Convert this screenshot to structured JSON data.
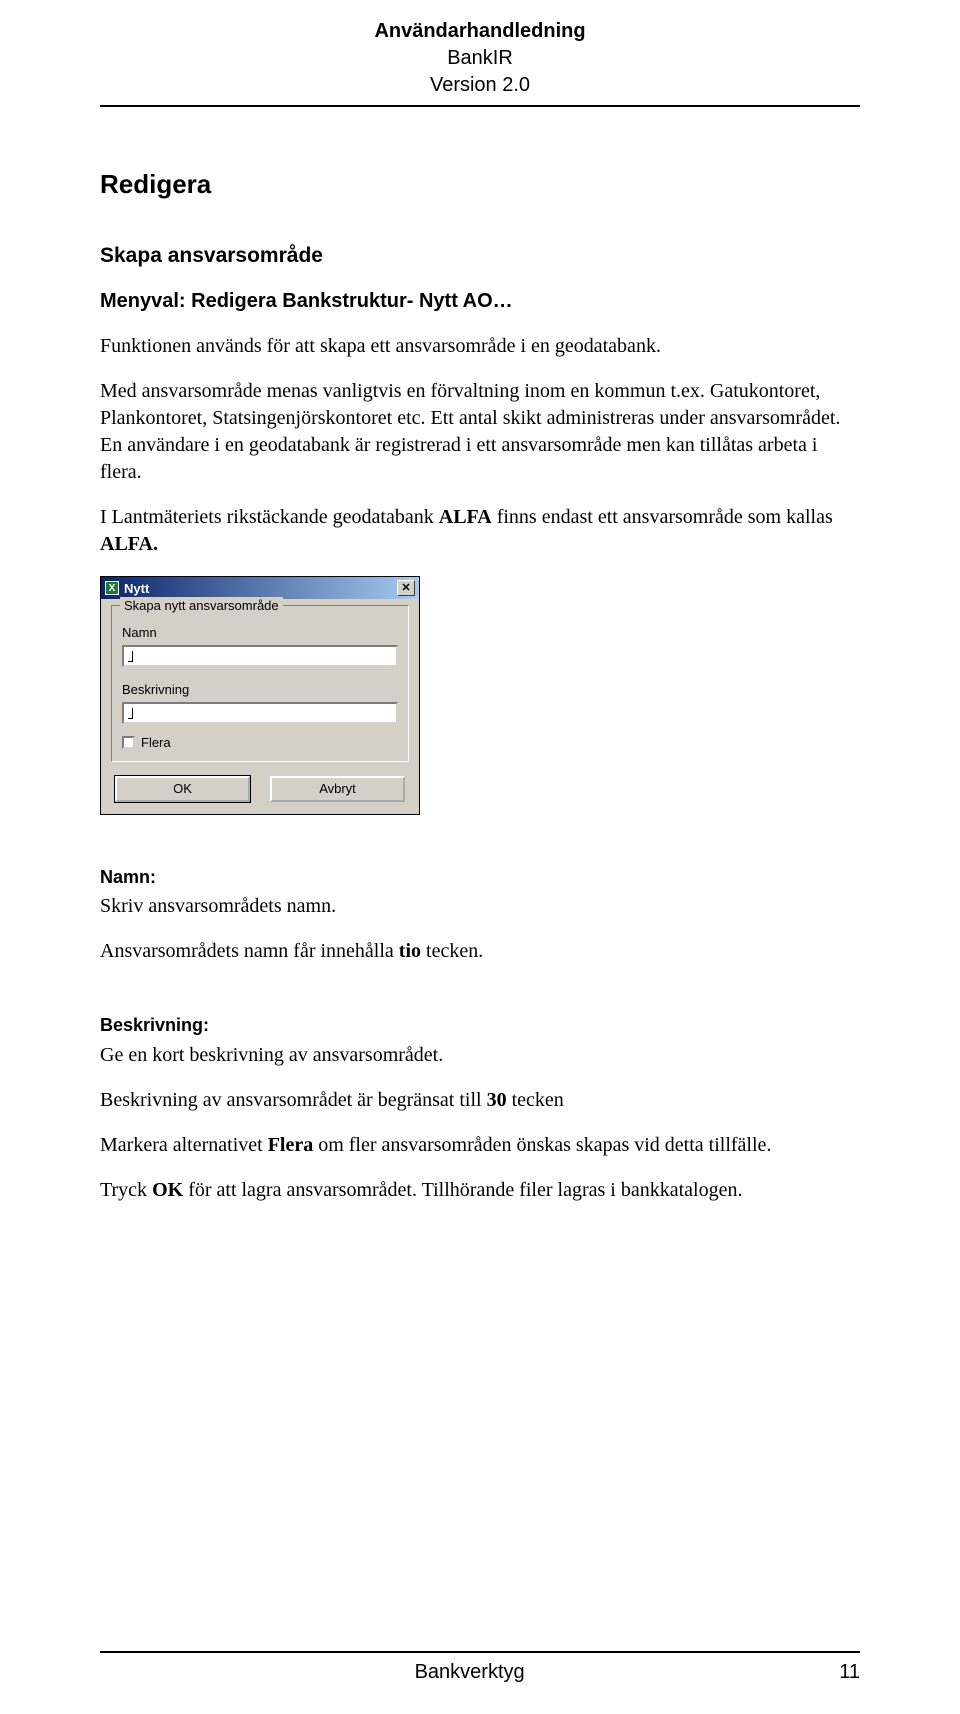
{
  "header": {
    "title": "Användarhandledning",
    "product": "BankIR",
    "version": "Version 2.0"
  },
  "section": {
    "title": "Redigera",
    "subtitle": "Skapa ansvarsområde",
    "menuval": "Menyval: Redigera Bankstruktur- Nytt AO…",
    "p1": "Funktionen används för att skapa ett ansvarsområde i en geodatabank.",
    "p2": "Med ansvarsområde menas vanligtvis en förvaltning inom en kommun t.ex. Gatukontoret, Plankontoret, Statsingenjörskontoret etc. Ett antal skikt administreras under ansvarsområdet. En användare i en geodatabank är registrerad i ett ansvarsområde men kan tillåtas arbeta i flera.",
    "p3_pre": "I Lantmäteriets rikstäckande geodatabank ",
    "p3_b1": "ALFA",
    "p3_mid": " finns endast ett ansvarsområde som kallas ",
    "p3_b2": "ALFA.",
    "namn_label": "Namn:",
    "namn_p1": "Skriv ansvarsområdets namn.",
    "namn_p2_pre": "Ansvarsområdets namn får innehålla ",
    "namn_p2_b": "tio",
    "namn_p2_post": " tecken.",
    "beskr_label": "Beskrivning:",
    "beskr_p1": "Ge en kort beskrivning av ansvarsområdet.",
    "beskr_p2_pre": "Beskrivning av ansvarsområdet är begränsat till ",
    "beskr_p2_b": "30",
    "beskr_p2_post": " tecken",
    "beskr_p3_pre": "Markera alternativet ",
    "beskr_p3_b": "Flera",
    "beskr_p3_post": " om fler ansvarsområden önskas skapas vid detta tillfälle.",
    "beskr_p4_pre": "Tryck ",
    "beskr_p4_b": "OK",
    "beskr_p4_post": " för att lagra ansvarsområdet. Tillhörande filer lagras i bankkatalogen."
  },
  "dialog": {
    "app_icon_letter": "X",
    "title": "Nytt",
    "group_legend": "Skapa nytt ansvarsområde",
    "label_namn": "Namn",
    "label_beskr": "Beskrivning",
    "checkbox_label": "Flera",
    "btn_ok": "OK",
    "btn_cancel": "Avbryt"
  },
  "footer": {
    "center": "Bankverktyg",
    "pagenum": "11"
  }
}
